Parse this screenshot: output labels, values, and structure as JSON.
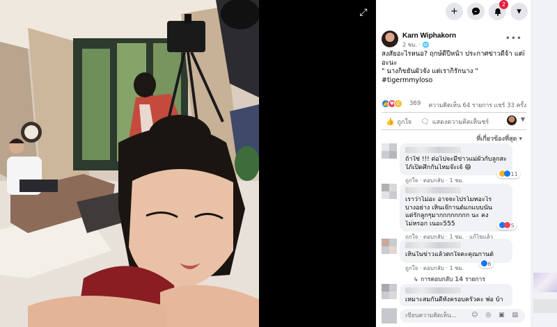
{
  "nav": {
    "create_icon": "+",
    "messenger_icon": "messenger-icon",
    "notifications_badge": "2",
    "account_caret": "▾"
  },
  "post": {
    "author": "Karn Wiphakorn",
    "time": "2 ชม.",
    "text_lines": [
      "สงสัยอะไรหนอ? ฤกษ์ดีปีหน้า ประกาศข่าวดีจ้า แต่ก็",
      "อะนะ",
      "\" นางก็ขยันผัวจัง แต่เราก็รักนาง \"",
      "#tigermmyloso"
    ],
    "reaction_count": "369",
    "comments_shares": "ความคิดเห็น 64 รายการ  แชร์ 33 ครั้ง",
    "like_label": "ถูกใจ",
    "comment_label": "แสดงความคิดเห็นชร์",
    "sort_label": "ที่เกี่ยวข้องที่สุด ▾"
  },
  "comments": [
    {
      "lines": [
        "ถ้าใช่ !!! ต่อไปจะมีข่าวแม่ผัวกับลูกสะ",
        "ใภ้เปิดศึกกันไหมจ๊ะเจ้ 😄"
      ],
      "react_count": "11",
      "meta": "ถูกใจ · ตอบกลับ · 1 ชม."
    },
    {
      "lines": [
        "เราว่าไม่อะ อาจจะโปรโมทอะไร",
        "บางอย่าง เห็นเจ๊กานต์แกแบบนั้น",
        "แต่รักลูกๆมากกกกกกกก นะ คง",
        "ไม่หรอก เนอะ555"
      ],
      "react_count": "5",
      "meta": "ถูกใจ · ตอบกลับ · 1 ชม. · แก้ไขแล้ว"
    },
    {
      "lines": [
        "เห็นในข่าวแล้วตกใจคะคุณกานต์"
      ],
      "react_count": "6",
      "meta": "ถูกใจ · ตอบกลับ · 1 ชม.",
      "replies": "↳ การตอบกลับ 14 รายการ"
    },
    {
      "lines": [
        "เหมาะสมกันดีทั้งครอบครัวคะ พ่อ บ้า"
      ],
      "react_count": "",
      "meta": ""
    }
  ],
  "composer": {
    "placeholder": "เขียนความคิดเห็น...",
    "icons": "☺ ◎ ▣ ▤"
  },
  "colors": {
    "like_blue": "#1877f2",
    "love_red": "#f33e58",
    "wow_yellow": "#f7b125",
    "badge_red": "#e41e3f"
  }
}
